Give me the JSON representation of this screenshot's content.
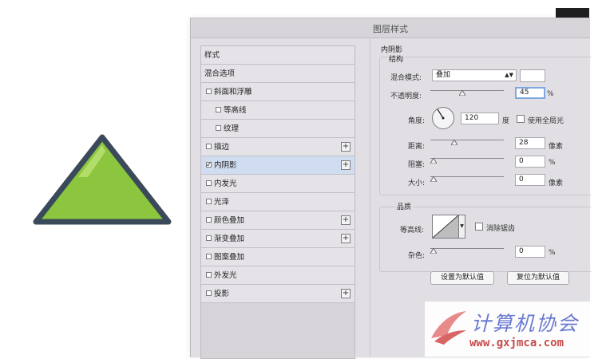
{
  "dialog": {
    "title": "图层样式"
  },
  "styles_list": [
    {
      "label": "样式",
      "checkbox": false,
      "checked": false,
      "plus": false,
      "indent": 0,
      "selected": false
    },
    {
      "label": "混合选项",
      "checkbox": false,
      "checked": false,
      "plus": false,
      "indent": 0,
      "selected": false
    },
    {
      "label": "斜面和浮雕",
      "checkbox": true,
      "checked": false,
      "plus": false,
      "indent": 0,
      "selected": false
    },
    {
      "label": "等高线",
      "checkbox": true,
      "checked": false,
      "plus": false,
      "indent": 1,
      "selected": false
    },
    {
      "label": "纹理",
      "checkbox": true,
      "checked": false,
      "plus": false,
      "indent": 1,
      "selected": false
    },
    {
      "label": "描边",
      "checkbox": true,
      "checked": false,
      "plus": true,
      "indent": 0,
      "selected": false
    },
    {
      "label": "内阴影",
      "checkbox": true,
      "checked": true,
      "plus": true,
      "indent": 0,
      "selected": true
    },
    {
      "label": "内发光",
      "checkbox": true,
      "checked": false,
      "plus": false,
      "indent": 0,
      "selected": false
    },
    {
      "label": "光泽",
      "checkbox": true,
      "checked": false,
      "plus": false,
      "indent": 0,
      "selected": false
    },
    {
      "label": "颜色叠加",
      "checkbox": true,
      "checked": false,
      "plus": true,
      "indent": 0,
      "selected": false
    },
    {
      "label": "渐变叠加",
      "checkbox": true,
      "checked": false,
      "plus": true,
      "indent": 0,
      "selected": false
    },
    {
      "label": "图案叠加",
      "checkbox": true,
      "checked": false,
      "plus": false,
      "indent": 0,
      "selected": false
    },
    {
      "label": "外发光",
      "checkbox": true,
      "checked": false,
      "plus": false,
      "indent": 0,
      "selected": false
    },
    {
      "label": "投影",
      "checkbox": true,
      "checked": false,
      "plus": true,
      "indent": 0,
      "selected": false
    }
  ],
  "inner_shadow": {
    "header": "内阴影",
    "structure": {
      "header": "结构",
      "blend_mode_label": "混合模式:",
      "blend_mode_value": "叠加",
      "blend_color": "#ffffff",
      "opacity_label": "不透明度:",
      "opacity_value": "45",
      "opacity_unit": "%",
      "angle_label": "角度:",
      "angle_value": "120",
      "angle_unit": "度",
      "global_light_label": "使用全局光",
      "global_light_checked": false,
      "distance_label": "距离:",
      "distance_value": "28",
      "distance_unit": "像素",
      "choke_label": "阻塞:",
      "choke_value": "0",
      "choke_unit": "%",
      "size_label": "大小:",
      "size_value": "0",
      "size_unit": "像素"
    },
    "quality": {
      "header": "品质",
      "contour_label": "等高线:",
      "anti_alias_label": "消除锯齿",
      "anti_alias_checked": false,
      "noise_label": "杂色:",
      "noise_value": "0",
      "noise_unit": "%"
    },
    "buttons": {
      "set_default": "设置为默认值",
      "reset_default": "复位为默认值"
    }
  },
  "watermark": {
    "title": "计算机协会",
    "url": "www.gxjmca.com"
  },
  "colors": {
    "dialog_bg": "#e1dfe4",
    "selected_row": "#d0dcf0",
    "triangle_fill": "#8cc63f",
    "triangle_stroke": "#3b4a5a",
    "focus_border": "#7fa8e0"
  }
}
